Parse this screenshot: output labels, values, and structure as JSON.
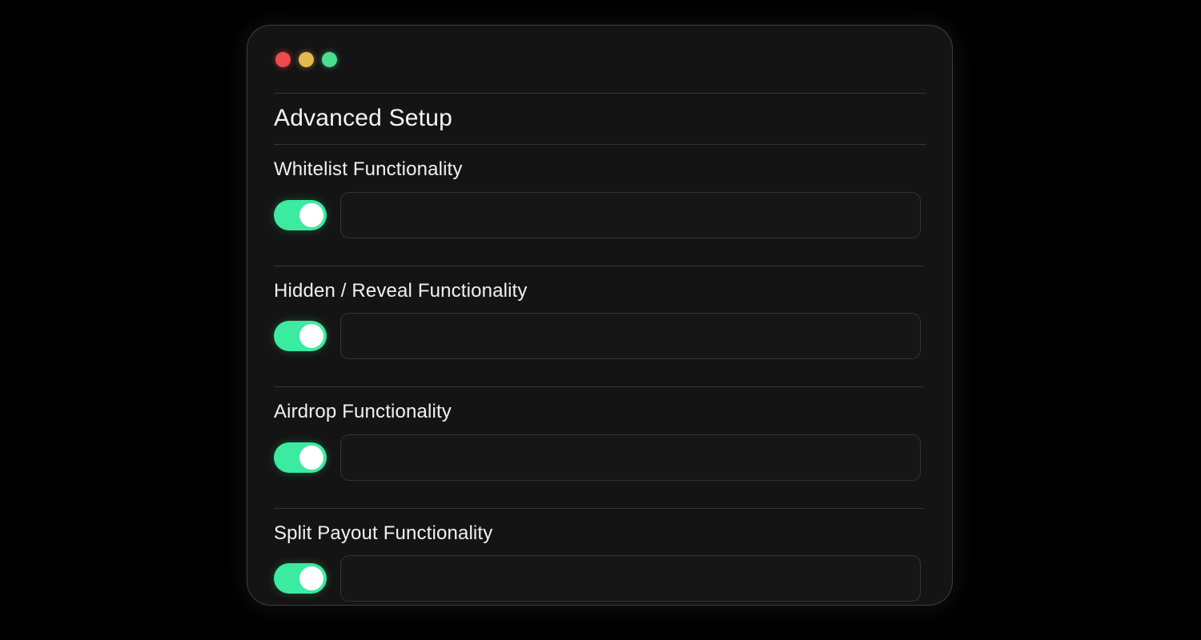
{
  "window": {
    "traffic_lights": [
      {
        "name": "close",
        "color": "#ee4b4b"
      },
      {
        "name": "minimize",
        "color": "#e5b94e"
      },
      {
        "name": "maximize",
        "color": "#4ade90"
      }
    ]
  },
  "header": {
    "title": "Advanced Setup"
  },
  "theme": {
    "page_background": "#000000",
    "window_background": "#141414",
    "accent_on": "#3bebA0",
    "knob": "#ffffff",
    "text": "#f1f1f2",
    "divider": "rgba(255,255,255,0.14)"
  },
  "sections": [
    {
      "label": "Whitelist Functionality",
      "toggle": {
        "name": "whitelist-functionality-toggle",
        "state": "on"
      },
      "input": {
        "name": "whitelist-functionality-input",
        "value": "",
        "placeholder": ""
      }
    },
    {
      "label": "Hidden / Reveal Functionality",
      "toggle": {
        "name": "hidden-reveal-functionality-toggle",
        "state": "on"
      },
      "input": {
        "name": "hidden-reveal-functionality-input",
        "value": "",
        "placeholder": ""
      }
    },
    {
      "label": "Airdrop Functionality",
      "toggle": {
        "name": "airdrop-functionality-toggle",
        "state": "on"
      },
      "input": {
        "name": "airdrop-functionality-input",
        "value": "",
        "placeholder": ""
      }
    },
    {
      "label": "Split Payout Functionality",
      "toggle": {
        "name": "split-payout-functionality-toggle",
        "state": "on"
      },
      "input": {
        "name": "split-payout-functionality-input",
        "value": "",
        "placeholder": ""
      }
    }
  ]
}
